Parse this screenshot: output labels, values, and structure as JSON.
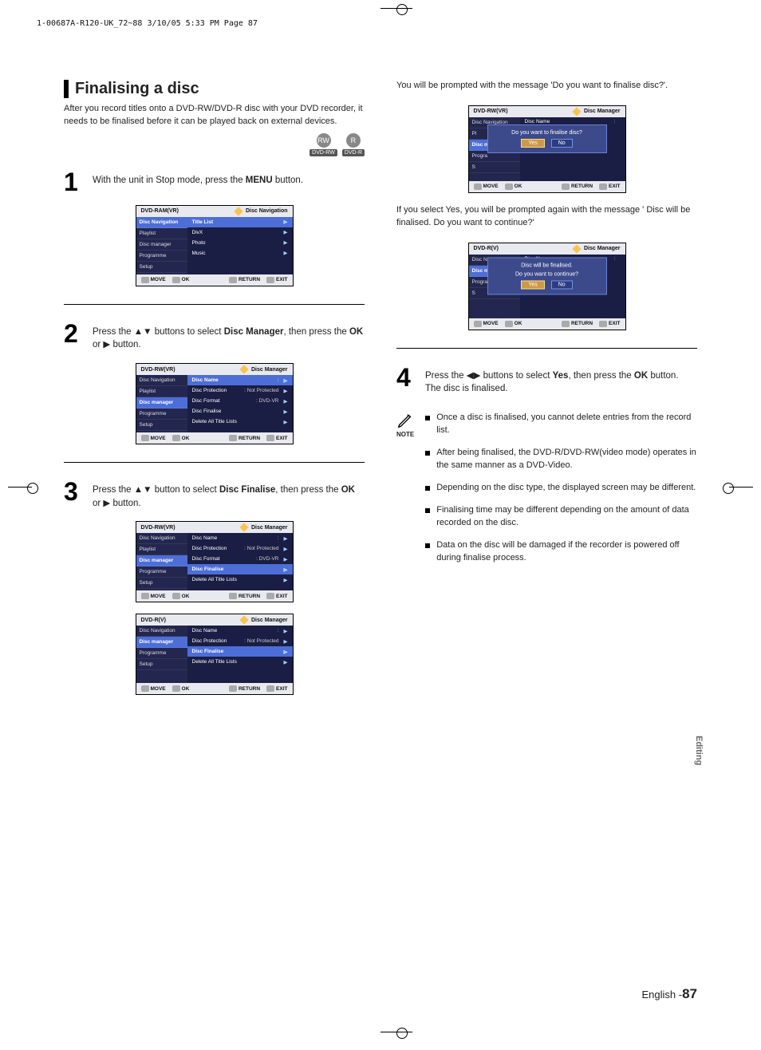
{
  "print_header": "1-00687A-R120-UK_72~88  3/10/05  5:33 PM  Page 87",
  "section": {
    "title": "Finalising a disc",
    "intro": "After you record titles onto a DVD-RW/DVD-R disc with your DVD recorder, it needs to be finalised before it can be played back on external devices."
  },
  "badges": {
    "rw": "DVD-RW",
    "r": "DVD-R"
  },
  "steps": {
    "s1": {
      "num": "1",
      "pre": "With the unit in Stop mode, press the ",
      "bold": "MENU",
      "post": " button."
    },
    "s2": {
      "num": "2",
      "pre": "Press the ▲▼ buttons to select ",
      "bold1": "Disc Manager",
      "mid": ", then press the ",
      "bold2": "OK",
      "post": " or ▶ button."
    },
    "s3": {
      "num": "3",
      "pre": "Press the ▲▼ button to select ",
      "bold1": "Disc Finalise",
      "mid": ", then press the ",
      "bold2": "OK",
      "post": " or ▶ button."
    },
    "s4": {
      "num": "4",
      "pre": "Press the ◀▶ buttons to select ",
      "bold1": "Yes",
      "mid": ", then press the ",
      "bold2": "OK",
      "post": " button.",
      "after": "The disc is finalised."
    }
  },
  "osd_common": {
    "nav": "Disc Navigation",
    "playlist": "Playlist",
    "discmgr": "Disc manager",
    "prog": "Programme",
    "setup": "Setup",
    "title_nav": "Disc Navigation",
    "title_mgr": "Disc Manager",
    "footer": {
      "move": "MOVE",
      "ok": "OK",
      "return": "RETURN",
      "exit": "EXIT"
    },
    "rows": {
      "title_list": "Title List",
      "divx": "DivX",
      "photo": "Photo",
      "music": "Music",
      "disc_name": "Disc Name",
      "disc_protection": "Disc Protection",
      "not_protected": ": Not Protected",
      "disc_format": "Disc Format",
      "dvd_vr": ": DVD-VR",
      "disc_finalise": "Disc Finalise",
      "delete_all": "Delete All Title Lists",
      "colon": ":"
    }
  },
  "osds": {
    "a": {
      "hdr": "DVD-RAM(VR)"
    },
    "b": {
      "hdr": "DVD-RW(VR)"
    },
    "c": {
      "hdr": "DVD-RW(VR)"
    },
    "d": {
      "hdr": "DVD-R(V)"
    },
    "e": {
      "hdr": "DVD-RW(VR)",
      "dialog": "Do you want to finalise disc?"
    },
    "f": {
      "hdr": "DVD-R(V)",
      "d1": "Disc will be finalised.",
      "d2": "Do you want to continue?"
    },
    "yes": "Yes",
    "no": "No"
  },
  "right": {
    "p1": "You will be prompted with the message 'Do you want to finalise disc?'.",
    "p2": "If you select Yes, you will be prompted again with the message ' Disc will be finalised. Do you want to continue?'"
  },
  "note_label": "NOTE",
  "notes": [
    "Once a disc is finalised, you cannot delete entries from the record list.",
    "After being finalised, the DVD-R/DVD-RW(video mode) operates in the same manner as a DVD-Video.",
    "Depending on the disc type, the displayed screen may be different.",
    "Finalising time may be different depending on the amount of data recorded on the disc.",
    "Data on the disc will be damaged if the recorder is powered off during finalise process."
  ],
  "side_tab": "Editing",
  "footer": {
    "lang": "English -",
    "page": "87"
  }
}
